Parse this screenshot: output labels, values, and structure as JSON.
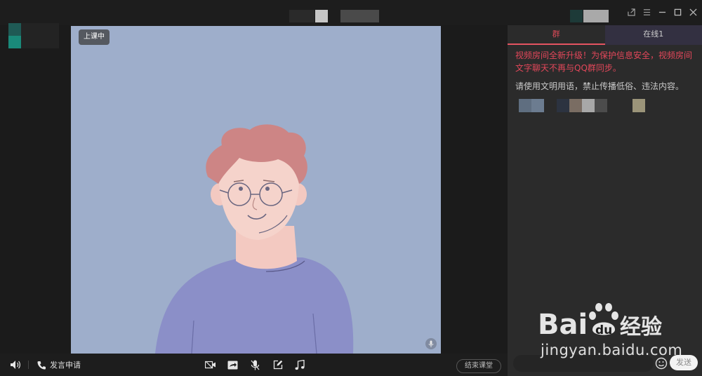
{
  "video": {
    "status_label": "上课中"
  },
  "chat": {
    "tabs": [
      {
        "label": "群"
      },
      {
        "label": "在线1"
      }
    ],
    "notice": "视频房间全新升级！为保护信息安全，视频房间文字聊天不再与QQ群同步。",
    "rule": "请使用文明用语，禁止传播低俗、违法内容。",
    "input_placeholder": "",
    "send_label": "发送"
  },
  "bottombar": {
    "speak_request_label": "发言申请",
    "end_class_label": "结束课堂"
  },
  "icons": {
    "volume": "volume-icon",
    "phone": "phone-icon",
    "camera": "camera-off-icon",
    "share": "screen-share-icon",
    "mic": "mic-off-icon",
    "edit": "edit-icon",
    "music": "music-icon",
    "emoji": "emoji-icon"
  },
  "watermark": {
    "brand": "Bai du 经验",
    "url": "jingyan.baidu.com"
  },
  "colors": {
    "video_bg": "#9eaecb",
    "accent_red": "#e3475a",
    "panel_bg": "#2b2b2b"
  }
}
